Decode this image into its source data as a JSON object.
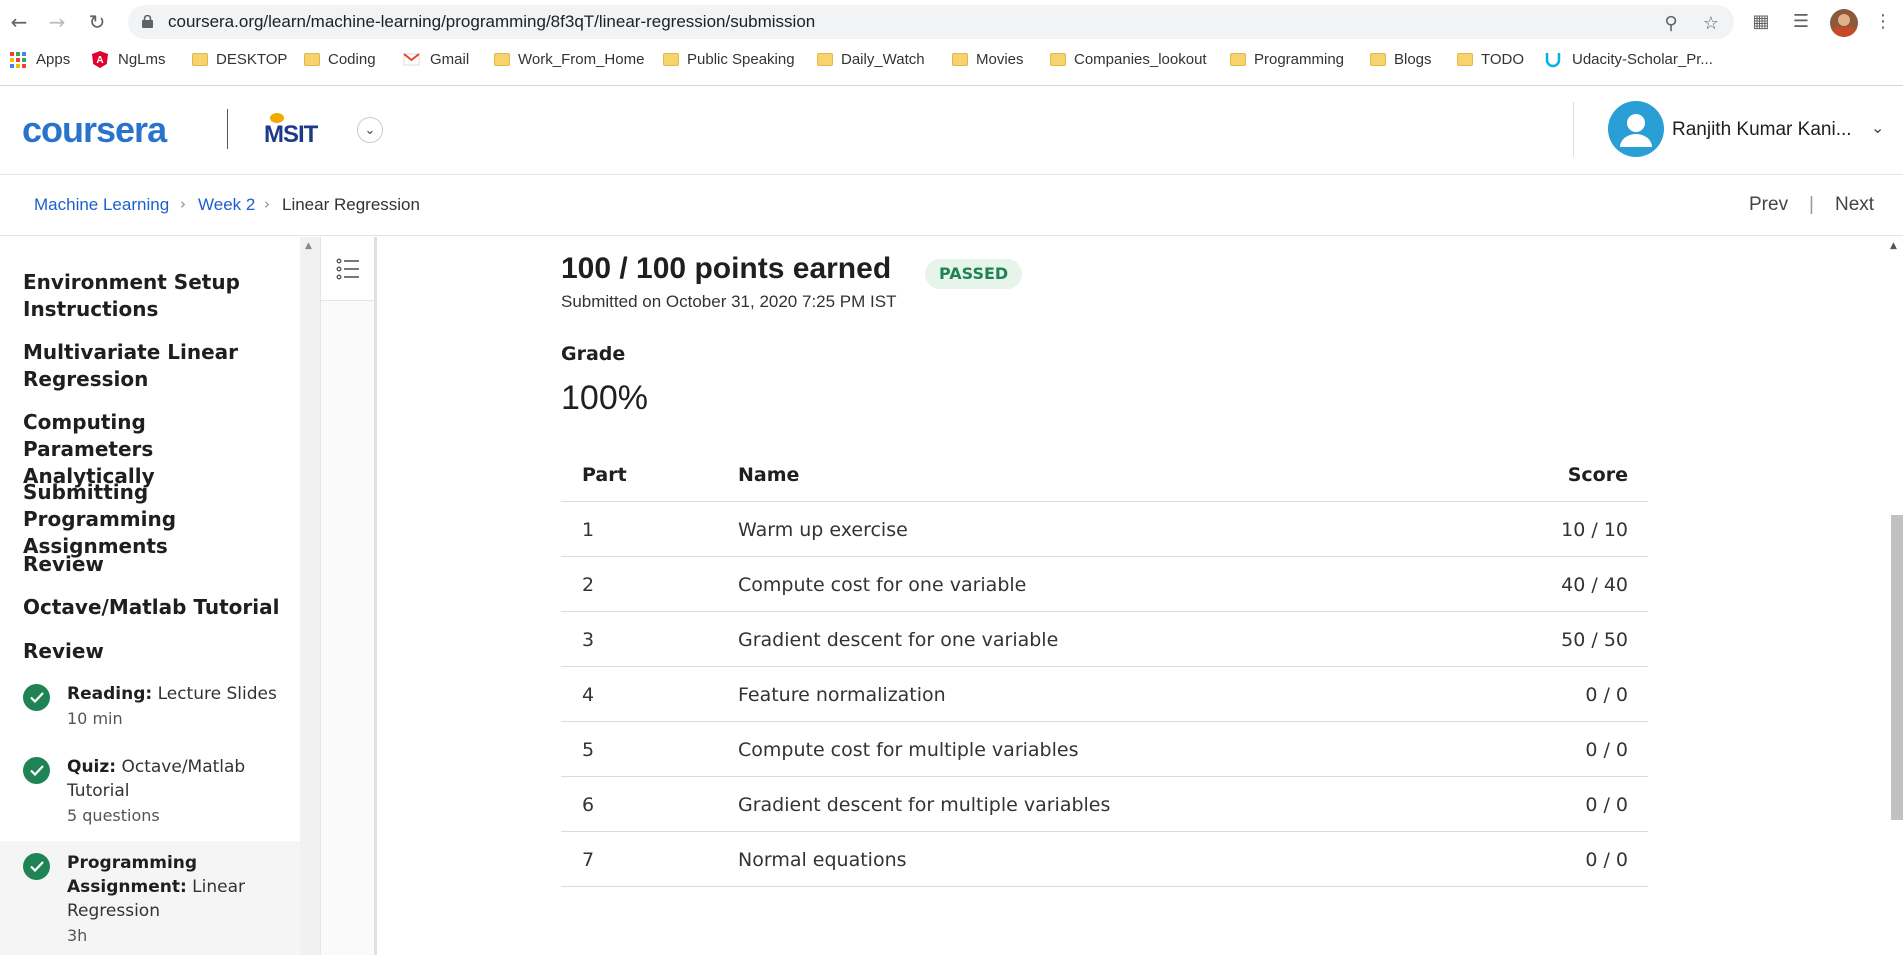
{
  "browser": {
    "url": "coursera.org/learn/machine-learning/programming/8f3qT/linear-regression/submission",
    "bookmarks": [
      "Apps",
      "NgLms",
      "DESKTOP",
      "Coding",
      "Gmail",
      "Work_From_Home",
      "Public Speaking",
      "Daily_Watch",
      "Movies",
      "Companies_lookout",
      "Programming",
      "Blogs",
      "TODO",
      "Udacity-Scholar_Pr..."
    ]
  },
  "header": {
    "logo": "coursera",
    "partner": "MSIT",
    "user_name": "Ranjith Kumar Kani..."
  },
  "breadcrumb": {
    "items": [
      "Machine Learning",
      "Week 2",
      "Linear Regression"
    ],
    "prev": "Prev",
    "next": "Next",
    "separator": "|"
  },
  "sidebar": {
    "items": [
      "Environment Setup Instructions",
      "Multivariate Linear Regression",
      "Computing Parameters Analytically",
      "Submitting Programming Assignments",
      "Review",
      "Octave/Matlab Tutorial",
      "Review"
    ],
    "subitems": [
      {
        "type": "Reading:",
        "title": "Lecture Slides",
        "meta": "10 min"
      },
      {
        "type": "Quiz:",
        "title": "Octave/Matlab Tutorial",
        "meta": "5 questions"
      },
      {
        "type": "Programming Assignment:",
        "title": "Linear Regression",
        "meta": "3h"
      }
    ]
  },
  "submission": {
    "points": "100 / 100 points earned",
    "status": "PASSED",
    "submitted": "Submitted on October 31, 2020 7:25 PM IST",
    "grade_label": "Grade",
    "grade_value": "100%",
    "columns": [
      "Part",
      "Name",
      "Score"
    ],
    "rows": [
      {
        "part": "1",
        "name": "Warm up exercise",
        "score": "10 / 10"
      },
      {
        "part": "2",
        "name": "Compute cost for one variable",
        "score": "40 / 40"
      },
      {
        "part": "3",
        "name": "Gradient descent for one variable",
        "score": "50 / 50"
      },
      {
        "part": "4",
        "name": "Feature normalization",
        "score": "0 / 0"
      },
      {
        "part": "5",
        "name": "Compute cost for multiple variables",
        "score": "0 / 0"
      },
      {
        "part": "6",
        "name": "Gradient descent for multiple variables",
        "score": "0 / 0"
      },
      {
        "part": "7",
        "name": "Normal equations",
        "score": "0 / 0"
      }
    ]
  },
  "colors": {
    "accent": "#2a73cc",
    "link": "#1e5fcf",
    "passed": "#1f8354",
    "passed_bg": "#e6f4ea"
  }
}
